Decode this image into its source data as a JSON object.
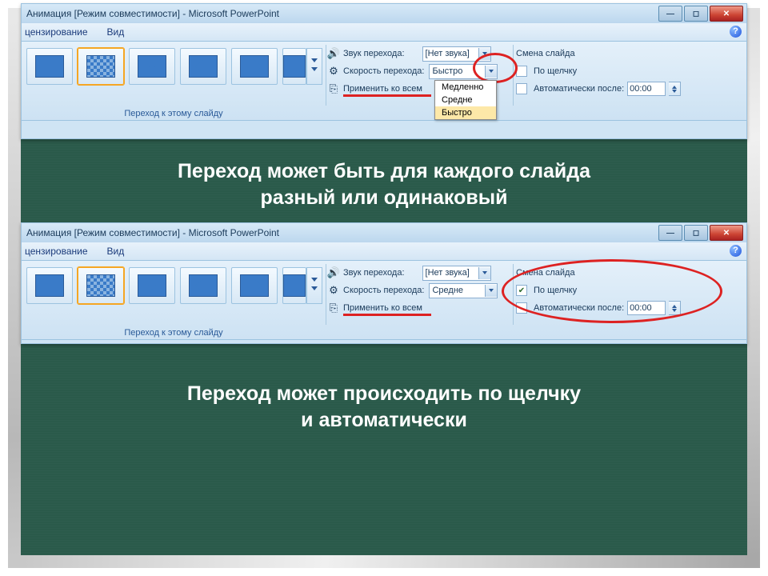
{
  "caption1": "Переход может быть для каждого слайда\nразный или одинаковый",
  "caption2": "Переход может происходить по щелчку\nи автоматически",
  "title": "Анимация [Режим совместимости] - Microsoft PowerPoint",
  "menu": {
    "m1": "цензирование",
    "m2": "Вид"
  },
  "group": {
    "label": "Переход к этому слайду"
  },
  "labels": {
    "sound": "Звук перехода:",
    "speed": "Скорость перехода:",
    "applyall": "Применить ко всем",
    "advance": "Смена слайда",
    "onclick": "По щелчку",
    "autoafter": "Автоматически после:"
  },
  "shot1": {
    "sound_value": "[Нет звука]",
    "speed_value": "Быстро",
    "auto_time": "00:00",
    "onclick_checked": false,
    "auto_checked": false,
    "dropdown": [
      "Медленно",
      "Средне",
      "Быстро"
    ],
    "dropdown_sel": "Быстро"
  },
  "shot2": {
    "sound_value": "[Нет звука]",
    "speed_value": "Средне",
    "auto_time": "00:00",
    "onclick_checked": true,
    "auto_checked": false
  }
}
